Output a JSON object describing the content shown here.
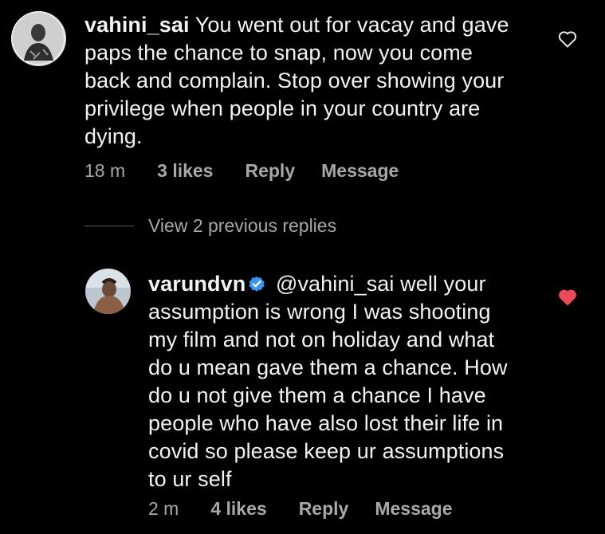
{
  "comment": {
    "username": "vahini_sai",
    "lines": [
      "You went out for vacay and gave",
      "paps the chance to snap, now you come",
      "back and complain. Stop over showing your",
      "privilege when people in your country are",
      "dying."
    ],
    "time": "18 m",
    "likes": "3 likes",
    "reply_label": "Reply",
    "message_label": "Message",
    "heart_icon": "heart-outline-icon"
  },
  "view_replies": {
    "label": "View 2 previous replies"
  },
  "reply": {
    "username": "varundvn",
    "verified_icon": "verified-badge-icon",
    "lines": [
      "@vahini_sai well  your",
      "assumption is wrong I was shooting",
      "my film and not on holiday  and what",
      "do u mean gave them a chance. How",
      "do u not give them a chance I have",
      "people who have also lost their life in",
      "covid so please keep ur assumptions",
      "to ur self"
    ],
    "time": "2 m",
    "likes": "4 likes",
    "reply_label": "Reply",
    "message_label": "Message",
    "heart_icon": "heart-filled-icon",
    "heart_color": "#ed4956"
  }
}
